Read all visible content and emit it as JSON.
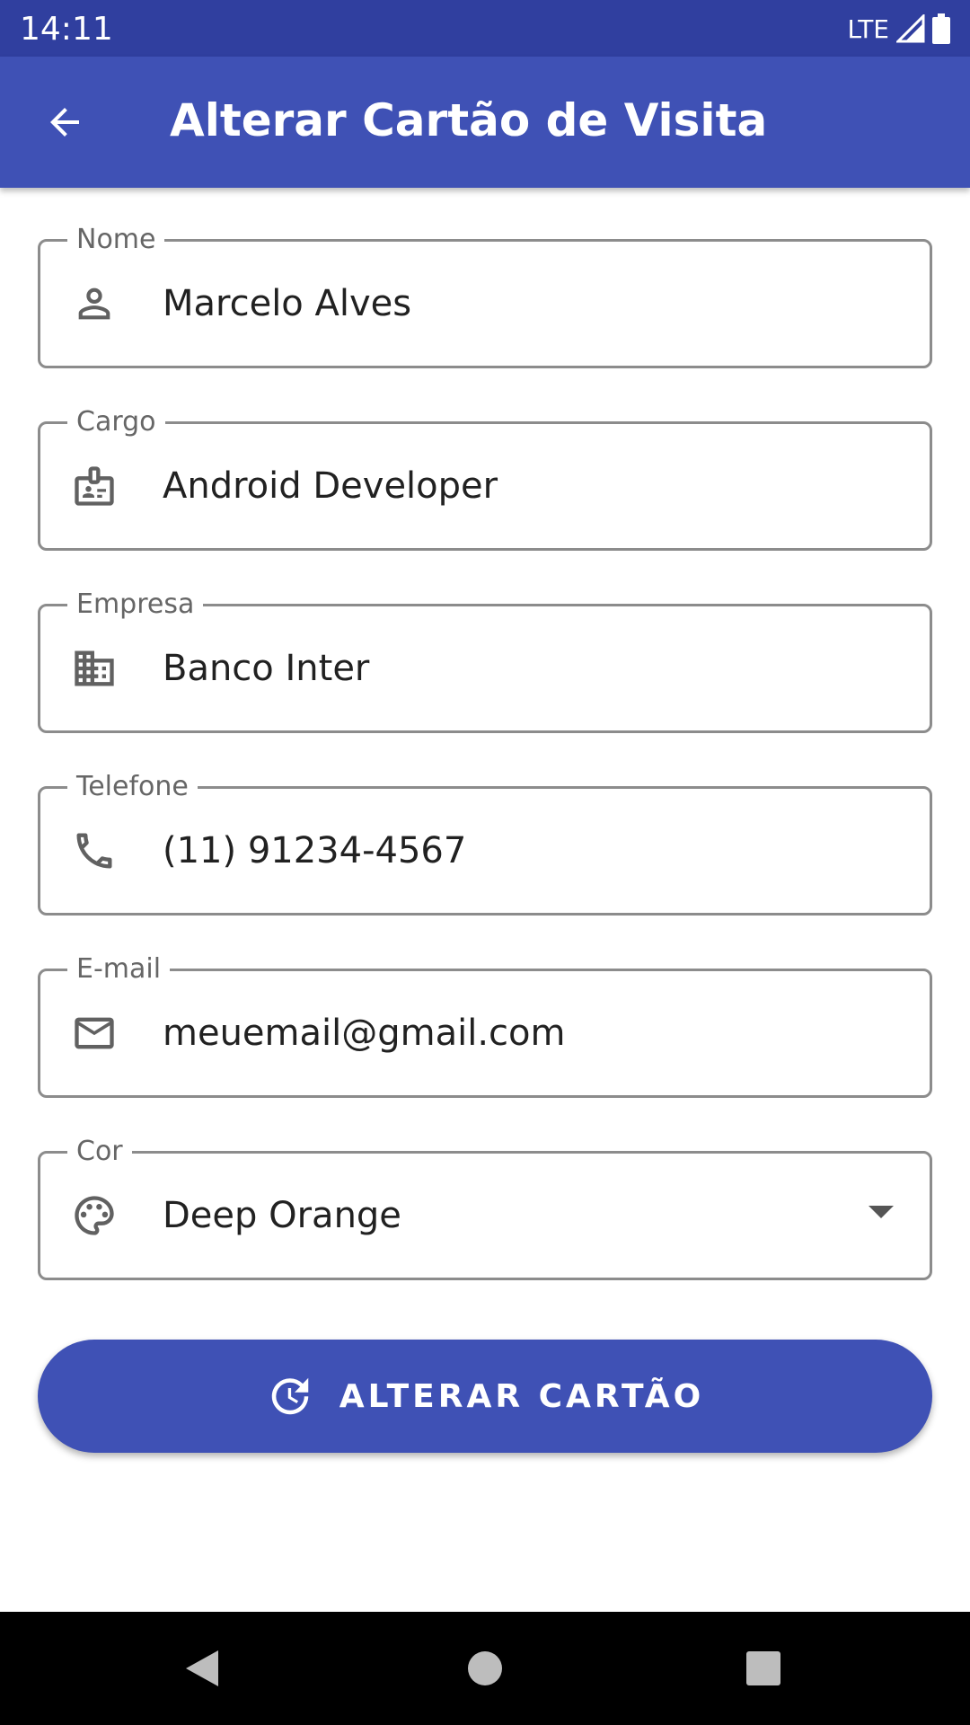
{
  "status_bar": {
    "time": "14:11",
    "network": "LTE"
  },
  "app_bar": {
    "title": "Alterar Cartão de Visita",
    "back_icon": "arrow-back-icon"
  },
  "form": {
    "nome": {
      "label": "Nome",
      "value": "Marcelo Alves",
      "icon": "person-icon"
    },
    "cargo": {
      "label": "Cargo",
      "value": "Android Developer",
      "icon": "badge-icon"
    },
    "empresa": {
      "label": "Empresa",
      "value": "Banco Inter",
      "icon": "business-icon"
    },
    "telefone": {
      "label": "Telefone",
      "value": "(11) 91234-4567",
      "icon": "phone-icon"
    },
    "email": {
      "label": "E-mail",
      "value": "meuemail@gmail.com",
      "icon": "mail-icon"
    },
    "cor": {
      "label": "Cor",
      "value": "Deep Orange",
      "icon": "palette-icon"
    }
  },
  "submit_button": {
    "label": "ALTERAR CARTÃO",
    "icon": "update-icon"
  },
  "colors": {
    "primary": "#3f51b5",
    "primary_dark": "#303f9f",
    "outline": "#8c8c8c",
    "icon": "#616161"
  }
}
